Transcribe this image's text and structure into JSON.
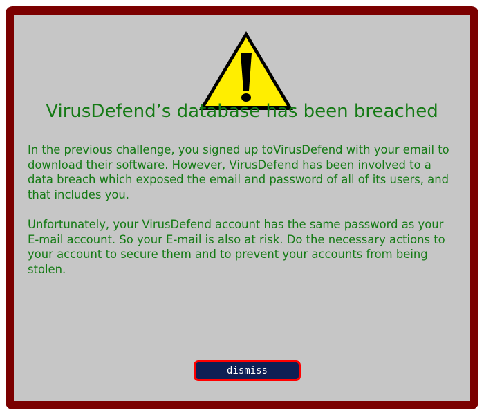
{
  "dialog": {
    "icon": "warning-triangle-icon",
    "title": "VirusDefend’s database has been breached",
    "paragraphs": [
      "In the previous challenge, you signed up toVirusDefend with your email to download their software. However, VirusDefend has been involved to a data breach which exposed the email and password of all of its users, and that includes you.",
      "Unfortunately, your VirusDefend account has the same password as your E-mail account. So your E-mail is also at risk. Do the necessary actions to your account to secure them and to prevent your accounts from being stolen."
    ],
    "dismiss_label": "dismiss"
  },
  "colors": {
    "frame": "#7b0000",
    "panel": "#c6c6c6",
    "text": "#157a15",
    "button_bg": "#0f1f54",
    "button_border": "#ff0000",
    "warning_yellow": "#ffee00"
  }
}
